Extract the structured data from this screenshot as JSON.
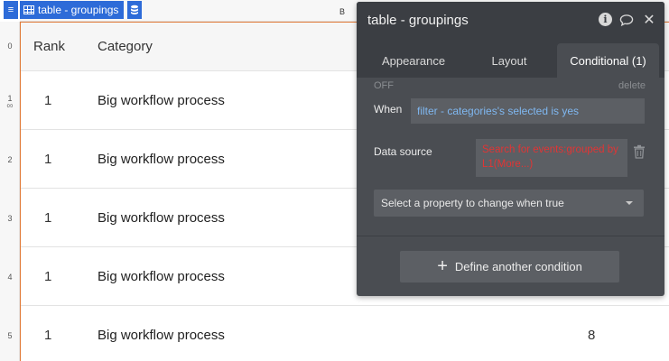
{
  "element_tab": {
    "label": "table - groupings"
  },
  "canvas": {
    "column_letter": "B",
    "row_numbers": [
      "0",
      "1",
      "2",
      "3",
      "4",
      "5"
    ],
    "link_glyph": "∞"
  },
  "table": {
    "headers": {
      "rank": "Rank",
      "category": "Category"
    },
    "rows": [
      {
        "rank": "1",
        "category": "Big workflow process",
        "count": ""
      },
      {
        "rank": "1",
        "category": "Big workflow process",
        "count": ""
      },
      {
        "rank": "1",
        "category": "Big workflow process",
        "count": ""
      },
      {
        "rank": "1",
        "category": "Big workflow process",
        "count": ""
      },
      {
        "rank": "1",
        "category": "Big workflow process",
        "count": "8"
      }
    ]
  },
  "panel": {
    "title": "table - groupings",
    "tabs": [
      {
        "label": "Appearance"
      },
      {
        "label": "Layout"
      },
      {
        "label": "Conditional (1)"
      }
    ],
    "condition": {
      "off_label": "OFF",
      "delete_label": "delete",
      "when_label": "When",
      "when_value": "filter - categories's selected is yes",
      "data_source_label": "Data source",
      "data_source_value": "Search for events:grouped by L1(More...)",
      "property_select": "Select a property to change when true"
    },
    "define_button": "Define another condition"
  },
  "colors": {
    "accent_blue": "#2d6bd8",
    "panel_bg": "#4a4d52",
    "expression_blue": "#7fb7f0",
    "error_red": "#e03535",
    "table_outline": "#e07a38"
  }
}
